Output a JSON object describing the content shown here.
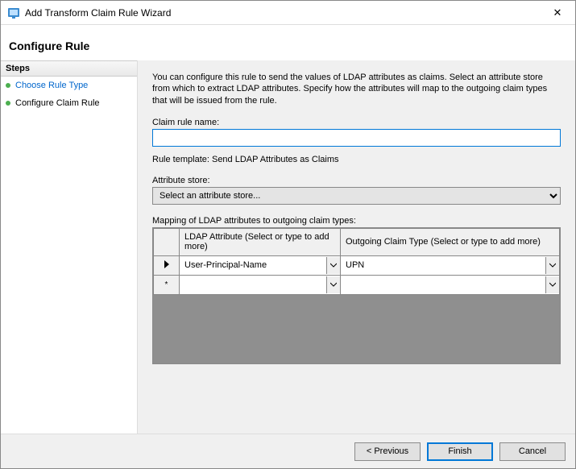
{
  "window": {
    "title": "Add Transform Claim Rule Wizard",
    "close_label": "✕"
  },
  "subtitle": "Configure Rule",
  "steps": {
    "header": "Steps",
    "items": [
      {
        "label": "Choose Rule Type",
        "link": true
      },
      {
        "label": "Configure Claim Rule",
        "link": false
      }
    ]
  },
  "content": {
    "instructions": "You can configure this rule to send the values of LDAP attributes as claims. Select an attribute store from which to extract LDAP attributes. Specify how the attributes will map to the outgoing claim types that will be issued from the rule.",
    "claim_rule_name_label": "Claim rule name:",
    "claim_rule_name_value": "",
    "rule_template_label": "Rule template: Send LDAP Attributes as Claims",
    "attribute_store_label": "Attribute store:",
    "attribute_store_selected": "Select an attribute store...",
    "mapping_label": "Mapping of LDAP attributes to outgoing claim types:",
    "grid": {
      "col_ldap": "LDAP Attribute (Select or type to add more)",
      "col_claim": "Outgoing Claim Type (Select or type to add more)",
      "rows": [
        {
          "marker": "current",
          "ldap": "User-Principal-Name",
          "claim": "UPN"
        },
        {
          "marker": "new",
          "ldap": "",
          "claim": ""
        }
      ]
    }
  },
  "footer": {
    "previous": "< Previous",
    "finish": "Finish",
    "cancel": "Cancel"
  }
}
